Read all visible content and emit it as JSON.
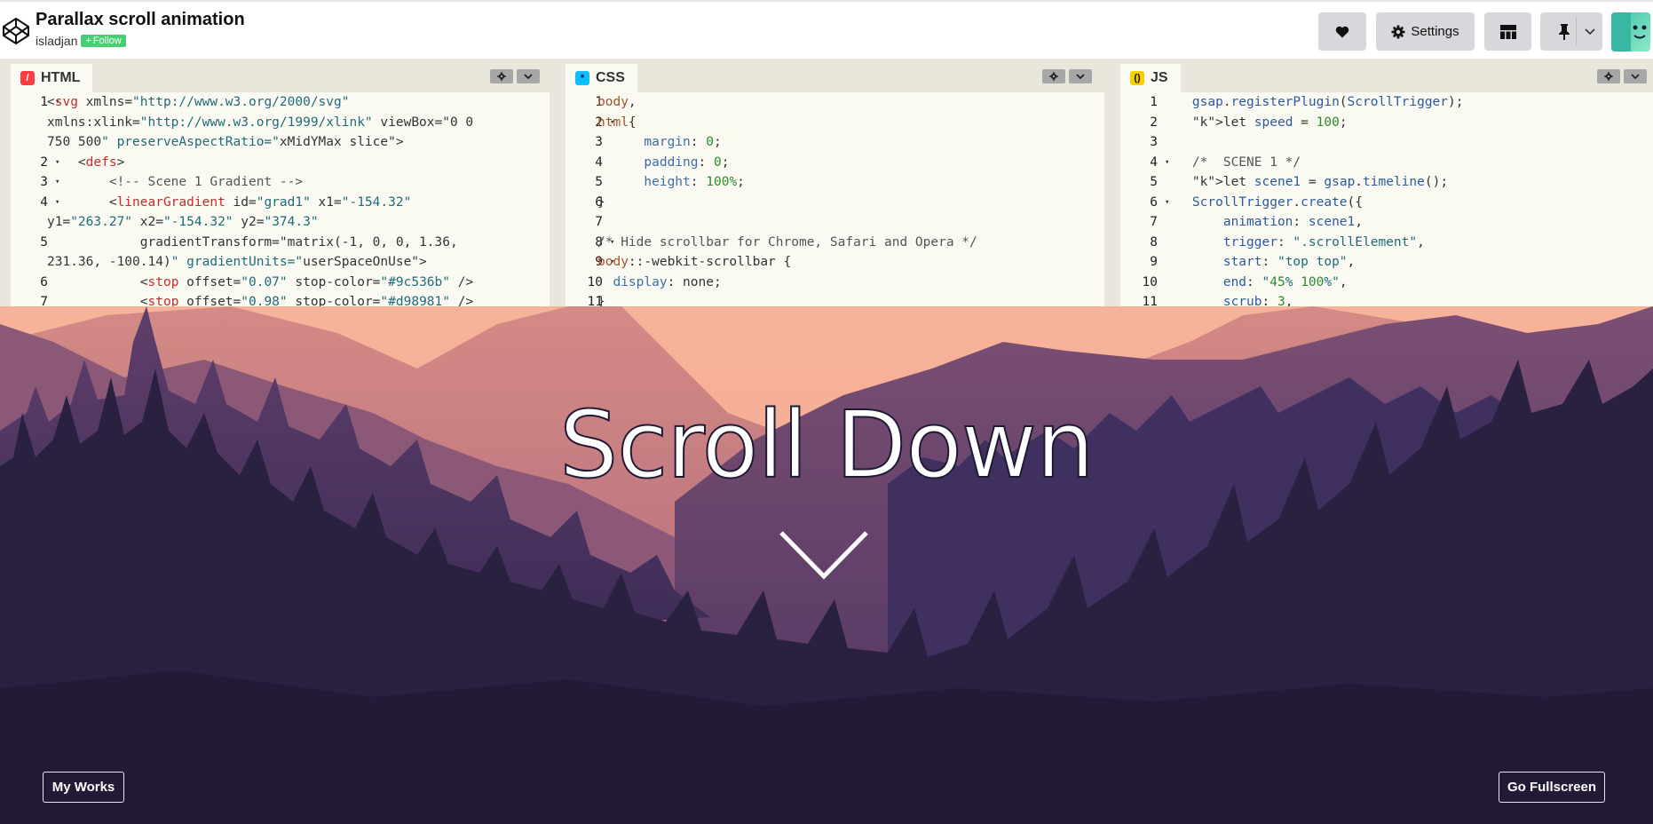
{
  "header": {
    "title": "Parallax scroll animation",
    "author": "isladjan",
    "follow_label": "Follow",
    "settings_label": "Settings"
  },
  "editors": {
    "html": {
      "label": "HTML",
      "lines": [
        {
          "n": "1",
          "fold": true
        },
        {
          "n": "",
          "fold": false
        },
        {
          "n": "",
          "fold": false
        },
        {
          "n": "2",
          "fold": true
        },
        {
          "n": "3",
          "fold": true
        },
        {
          "n": "4",
          "fold": true
        },
        {
          "n": "",
          "fold": false
        },
        {
          "n": "5",
          "fold": false
        },
        {
          "n": "",
          "fold": false
        },
        {
          "n": "6",
          "fold": false
        },
        {
          "n": "7",
          "fold": false
        }
      ],
      "code": [
        "<svg xmlns=\"http://www.w3.org/2000/svg\"",
        "xmlns:xlink=\"http://www.w3.org/1999/xlink\" viewBox=\"0 0",
        "750 500\" preserveAspectRatio=\"xMidYMax slice\">",
        "    <defs>",
        "        <!-- Scene 1 Gradient -->",
        "        <linearGradient id=\"grad1\" x1=\"-154.32\"",
        "y1=\"263.27\" x2=\"-154.32\" y2=\"374.3\"",
        "            gradientTransform=\"matrix(-1, 0, 0, 1.36,",
        "231.36, -100.14)\" gradientUnits=\"userSpaceOnUse\">",
        "            <stop offset=\"0.07\" stop-color=\"#9c536b\" />",
        "            <stop offset=\"0.98\" stop-color=\"#d98981\" />"
      ]
    },
    "css": {
      "label": "CSS",
      "lines": [
        {
          "n": "1",
          "fold": false
        },
        {
          "n": "2",
          "fold": true
        },
        {
          "n": "3",
          "fold": false
        },
        {
          "n": "4",
          "fold": false
        },
        {
          "n": "5",
          "fold": false
        },
        {
          "n": "6",
          "fold": false
        },
        {
          "n": "7",
          "fold": false
        },
        {
          "n": "8",
          "fold": true
        },
        {
          "n": "9",
          "fold": true
        },
        {
          "n": "10",
          "fold": false
        },
        {
          "n": "11",
          "fold": false
        }
      ],
      "code": [
        "body,",
        "html{",
        "      margin: 0;",
        "      padding: 0;",
        "      height: 100%;",
        "}",
        "",
        "/* Hide scrollbar for Chrome, Safari and Opera */",
        "body::-webkit-scrollbar {",
        "  display: none;",
        "}"
      ]
    },
    "js": {
      "label": "JS",
      "lines": [
        {
          "n": "1",
          "fold": false
        },
        {
          "n": "2",
          "fold": false
        },
        {
          "n": "3",
          "fold": false
        },
        {
          "n": "4",
          "fold": true
        },
        {
          "n": "5",
          "fold": false
        },
        {
          "n": "6",
          "fold": true
        },
        {
          "n": "7",
          "fold": false
        },
        {
          "n": "8",
          "fold": false
        },
        {
          "n": "9",
          "fold": false
        },
        {
          "n": "10",
          "fold": false
        },
        {
          "n": "11",
          "fold": false
        }
      ],
      "code": [
        "    gsap.registerPlugin(ScrollTrigger);",
        "    let speed = 100;",
        "",
        "    /*  SCENE 1 */",
        "    let scene1 = gsap.timeline();",
        "    ScrollTrigger.create({",
        "        animation: scene1,",
        "        trigger: \".scrollElement\",",
        "        start: \"top top\",",
        "        end: \"45% 100%\",",
        "        scrub: 3,"
      ]
    }
  },
  "preview": {
    "headline": "Scroll Down",
    "my_works_label": "My Works",
    "fullscreen_label": "Go Fullscreen"
  },
  "colors": {
    "sky": "#f5b49b",
    "mountain_far": "#c97c7f",
    "mountain_mid": "#8c5877",
    "forest_dark": "#2a2040",
    "follow_green": "#47cf73"
  }
}
